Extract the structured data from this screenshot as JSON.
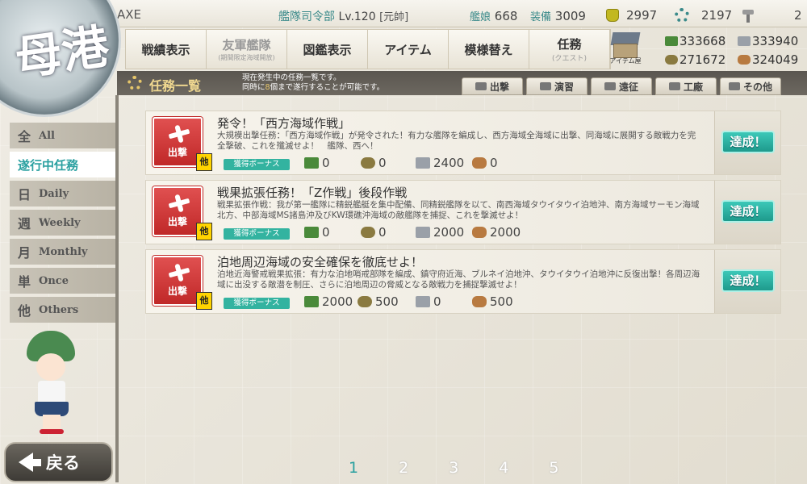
{
  "player": {
    "name": "AXE"
  },
  "hq": {
    "label": "艦隊司令部",
    "level": "Lv.120",
    "rank": "[元帥]"
  },
  "counts": {
    "shipgirls_label": "艦娘",
    "shipgirls": "668",
    "equipment_label": "装備",
    "equipment": "3009",
    "buckets": "2997",
    "dev_materials": "2197",
    "screws": "2"
  },
  "nav": [
    {
      "label": "戦績表示",
      "sub": ""
    },
    {
      "label": "友軍艦隊",
      "sub": "(期間限定海域開放)"
    },
    {
      "label": "図鑑表示",
      "sub": ""
    },
    {
      "label": "アイテム",
      "sub": ""
    },
    {
      "label": "模様替え",
      "sub": ""
    },
    {
      "label": "任務",
      "sub": "(クエスト)"
    }
  ],
  "shop": {
    "label": "アイテム屋"
  },
  "resources": {
    "fuel": "333668",
    "steel": "333940",
    "ammo": "271672",
    "bauxite": "324049"
  },
  "emblem": {
    "text": "母港"
  },
  "header": {
    "title": "任務一覧",
    "desc_line1": "現在発生中の任務一覧です。",
    "desc_line2_a": "同時に",
    "desc_line2_num": "8",
    "desc_line2_b": "個まで遂行することが可能です。"
  },
  "filter_tabs": [
    "出撃",
    "演習",
    "遠征",
    "工廠",
    "その他"
  ],
  "left_menu": [
    {
      "kanji": "全",
      "label": "All"
    },
    {
      "kanji": "",
      "label": "遂行中任務"
    },
    {
      "kanji": "日",
      "label": "Daily"
    },
    {
      "kanji": "週",
      "label": "Weekly"
    },
    {
      "kanji": "月",
      "label": "Monthly"
    },
    {
      "kanji": "単",
      "label": "Once"
    },
    {
      "kanji": "他",
      "label": "Others"
    }
  ],
  "quests": [
    {
      "category": "出撃",
      "badge": "他",
      "title": "発令！「西方海域作戦」",
      "desc": "大規模出撃任務：「西方海域作戦」が発令された！有力な艦隊を編成し、西方海域全海域に出撃、同海域に展開する敵戦力を完全撃破、これを殲滅せよ！　艦隊、西へ！",
      "bonus": "獲得ボーナス",
      "fuel": "0",
      "ammo": "0",
      "steel": "2400",
      "bauxite": "0",
      "status": "達成！"
    },
    {
      "category": "出撃",
      "badge": "他",
      "title": "戦果拡張任務！「Z作戦」後段作戦",
      "desc": "戦果拡張作戦：我が第一艦隊に精鋭艦艇を集中配備、同精鋭艦隊を以て、南西海域タウイタウイ泊地沖、南方海域サーモン海域北方、中部海域MS諸島沖及びKW環礁沖海域の敵艦隊を捕捉、これを撃滅せよ！",
      "bonus": "獲得ボーナス",
      "fuel": "0",
      "ammo": "0",
      "steel": "2000",
      "bauxite": "2000",
      "status": "達成！"
    },
    {
      "category": "出撃",
      "badge": "他",
      "title": "泊地周辺海域の安全確保を徹底せよ！",
      "desc": "泊地近海警戒戦果拡張：有力な泊地哨戒部隊を編成、鎮守府近海、ブルネイ泊地沖、タウイタウイ泊地沖に反復出撃！各周辺海域に出没する敵潜を制圧、さらに泊地周辺の脅威となる敵戦力を捕捉撃滅せよ！",
      "bonus": "獲得ボーナス",
      "fuel": "2000",
      "ammo": "500",
      "steel": "0",
      "bauxite": "500",
      "status": "達成！"
    }
  ],
  "pagination": {
    "pages": [
      "1",
      "2",
      "3",
      "4",
      "5"
    ],
    "current": "1"
  },
  "back_label": "戻る"
}
